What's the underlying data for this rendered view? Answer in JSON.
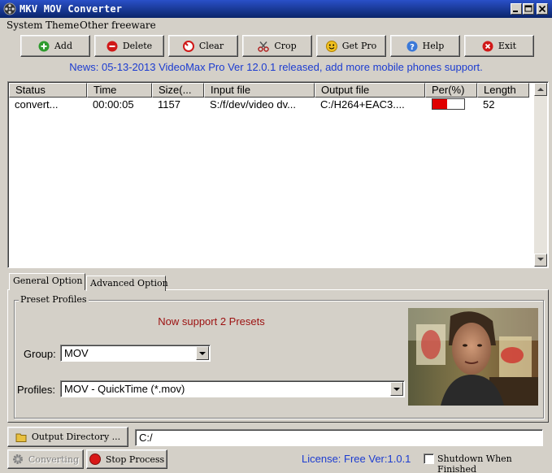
{
  "window": {
    "title": "MKV MOV Converter"
  },
  "menu": [
    "System",
    "Theme",
    "Other freeware"
  ],
  "toolbar": [
    {
      "label": "Add",
      "icon": "add-icon"
    },
    {
      "label": "Delete",
      "icon": "delete-icon"
    },
    {
      "label": "Clear",
      "icon": "clear-icon"
    },
    {
      "label": "Crop",
      "icon": "scissors-icon"
    },
    {
      "label": "Get Pro",
      "icon": "smiley-icon"
    },
    {
      "label": "Help",
      "icon": "help-icon"
    },
    {
      "label": "Exit",
      "icon": "exit-icon"
    }
  ],
  "news": "News: 05-13-2013 VideoMax Pro Ver 12.0.1 released, add more mobile phones support.",
  "list": {
    "columns": [
      "Status",
      "Time",
      "Size(...",
      "Input file",
      "Output file",
      "Per(%)",
      "Length"
    ],
    "rows": [
      {
        "status": "convert...",
        "time": "00:00:05",
        "size": "1157",
        "input": "S:/f/dev/video dv...",
        "output": "C:/H264+EAC3....",
        "percent": 0.45,
        "length": "52"
      }
    ]
  },
  "tabs": [
    "General Option",
    "Advanced Option"
  ],
  "options": {
    "group_title": "Preset Profiles",
    "presets_note": "Now support 2 Presets",
    "group_label": "Group:",
    "group_value": "MOV",
    "profiles_label": "Profiles:",
    "profiles_value": "MOV - QuickTime (*.mov)"
  },
  "bottom": {
    "output_dir_button": "Output Directory ...",
    "output_dir_value": "C:/",
    "converting_button": "Converting",
    "stop_button": "Stop Process",
    "license": "License: Free Ver:1.0.1",
    "shutdown_label": "Shutdown When Finished"
  },
  "colors": {
    "titlebar": "#0a246a",
    "news": "#1c3cd0",
    "presets": "#9c1010",
    "progress": "#e00000"
  }
}
